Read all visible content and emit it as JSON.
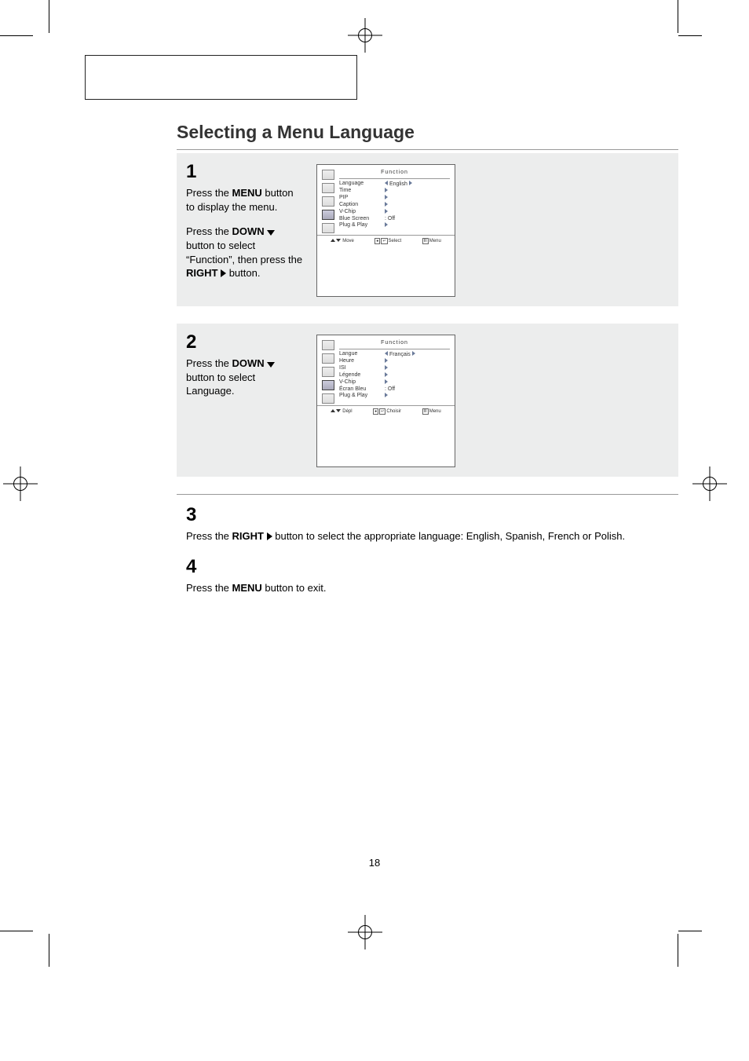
{
  "page_number": "18",
  "title": "Selecting a Menu Language",
  "steps": {
    "s1": {
      "num": "1",
      "p1a": "Press the ",
      "p1b": "MENU",
      "p1c": " button to display the menu.",
      "p2a": "Press the ",
      "p2b": "DOWN",
      "p2c": " button to select “Function”, then press the ",
      "p2d": "RIGHT",
      "p2e": " button."
    },
    "s2": {
      "num": "2",
      "p1a": "Press the ",
      "p1b": "DOWN",
      "p1c": " button to select Language."
    },
    "s3": {
      "num": "3",
      "p1a": "Press the ",
      "p1b": "RIGHT",
      "p1c": " button to select the appropriate language: English, Spanish, French or Polish."
    },
    "s4": {
      "num": "4",
      "p1a": "Press the ",
      "p1b": "MENU",
      "p1c": " button to exit."
    }
  },
  "osd1": {
    "title": "Function",
    "items": [
      {
        "label": "Language",
        "value": "English",
        "type": "sel"
      },
      {
        "label": "Time",
        "value": "",
        "type": "arrow"
      },
      {
        "label": "PIP",
        "value": "",
        "type": "arrow"
      },
      {
        "label": "Caption",
        "value": "",
        "type": "arrow"
      },
      {
        "label": "V-Chip",
        "value": "",
        "type": "arrow"
      },
      {
        "label": "Blue Screen",
        "value": ": Off",
        "type": "text"
      },
      {
        "label": "Plug & Play",
        "value": "",
        "type": "arrow"
      }
    ],
    "foot": {
      "a": "Move",
      "b": "Select",
      "c": "Menu"
    }
  },
  "osd2": {
    "title": "Function",
    "items": [
      {
        "label": "Langue",
        "value": "Français",
        "type": "sel"
      },
      {
        "label": "Heure",
        "value": "",
        "type": "arrow"
      },
      {
        "label": "ISI",
        "value": "",
        "type": "arrow"
      },
      {
        "label": "Légende",
        "value": "",
        "type": "arrow"
      },
      {
        "label": "V-Chip",
        "value": "",
        "type": "arrow"
      },
      {
        "label": "Écran Bleu",
        "value": ": Off",
        "type": "text"
      },
      {
        "label": "Plug & Play",
        "value": "",
        "type": "arrow"
      }
    ],
    "foot": {
      "a": "Dépl",
      "b": "Choisir",
      "c": "Menu"
    }
  }
}
